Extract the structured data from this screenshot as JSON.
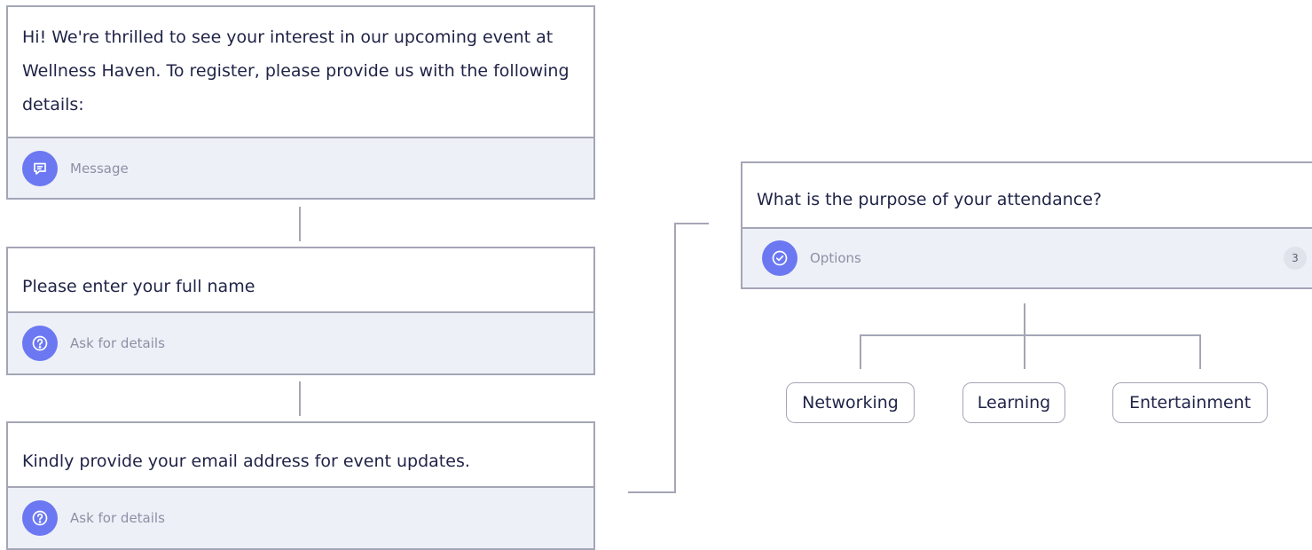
{
  "nodes": {
    "welcome": {
      "text": "Hi! We're thrilled to see your interest in our upcoming event at Wellness Haven. To register, please provide us with the following details:",
      "type_label": "Message",
      "icon": "message-icon"
    },
    "full_name": {
      "text": "Please enter your full name",
      "type_label": "Ask for details",
      "icon": "question-icon"
    },
    "email": {
      "text": "Kindly provide your email address for event updates.",
      "type_label": "Ask for details",
      "icon": "question-icon"
    },
    "purpose": {
      "text": "What is the purpose of your attendance?",
      "type_label": "Options",
      "icon": "check-circle-icon",
      "option_count": "3",
      "options": [
        "Networking",
        "Learning",
        "Entertainment"
      ]
    }
  },
  "colors": {
    "accent": "#6b78f2",
    "border": "#a4a6b6",
    "footer_bg": "#eef0f8",
    "text": "#1f2347",
    "muted_text": "#8d90a4"
  }
}
